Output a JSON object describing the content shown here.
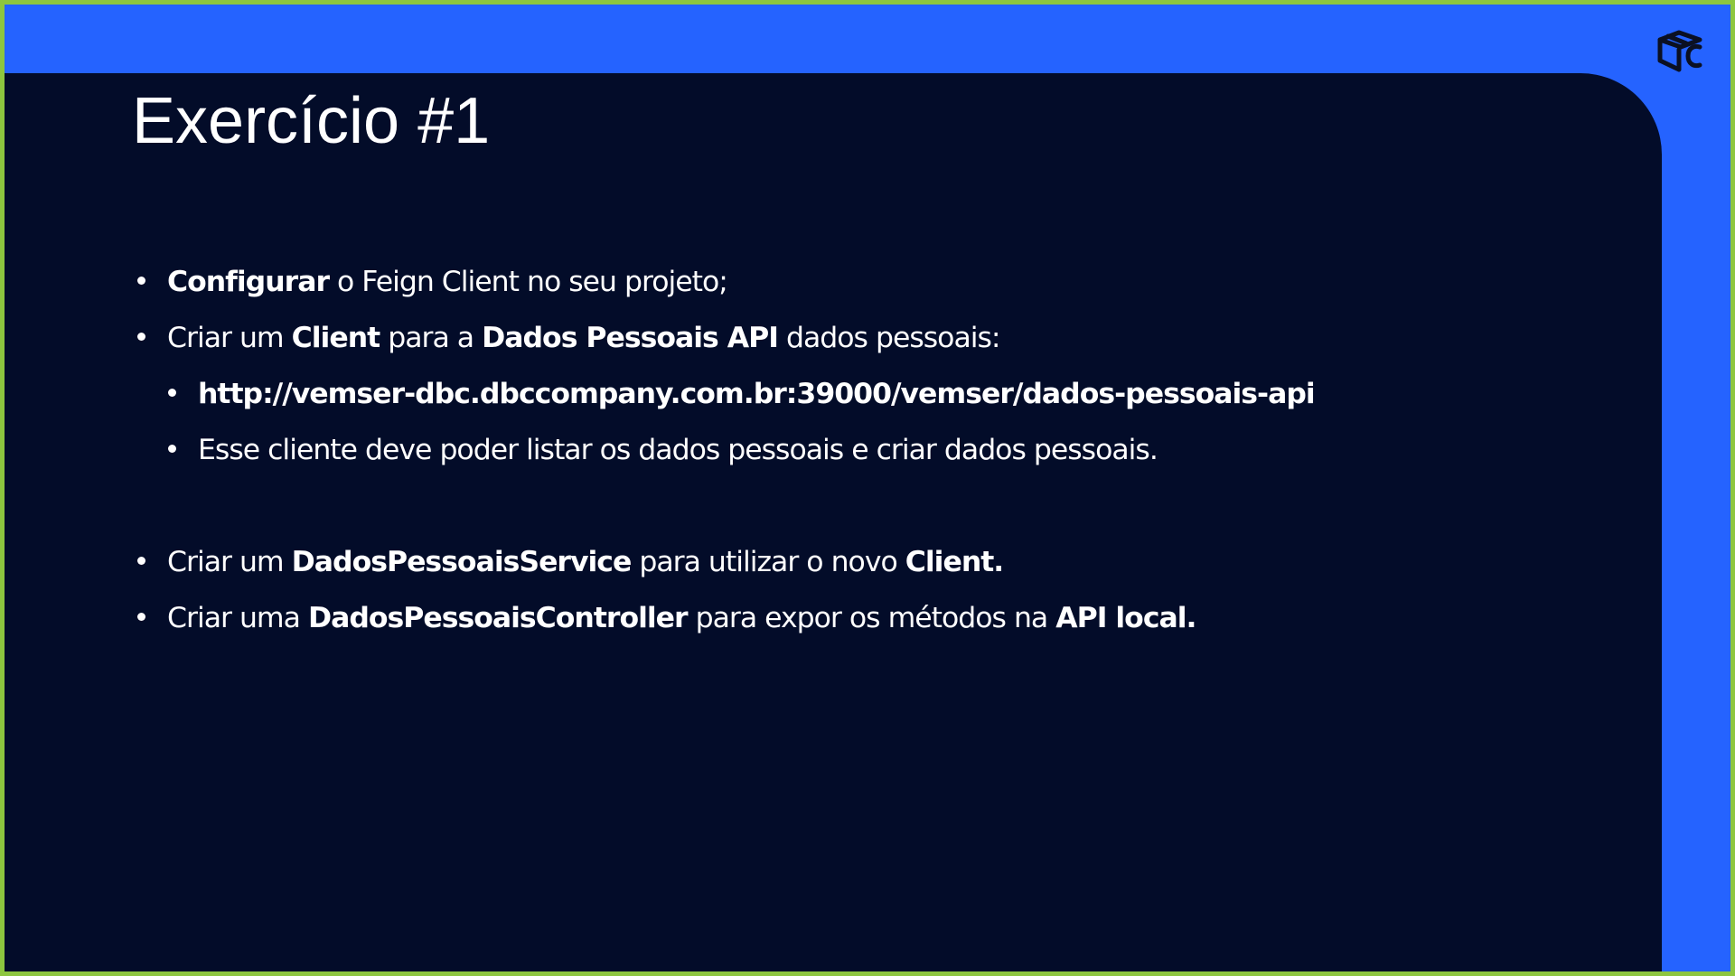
{
  "slide": {
    "title": "Exercício #1",
    "colors": {
      "accent": "#2563ff",
      "panel": "#030c29",
      "frame": "#8dc63f",
      "text": "#ffffff"
    },
    "logo_icon": "dbc-cube-logo-icon",
    "bullets": [
      {
        "level": 1,
        "parts": [
          {
            "text": "Configurar",
            "bold": true
          },
          {
            "text": " o Feign Client no seu projeto;",
            "bold": false
          }
        ]
      },
      {
        "level": 1,
        "parts": [
          {
            "text": "Criar um ",
            "bold": false
          },
          {
            "text": "Client",
            "bold": true
          },
          {
            "text": " para a ",
            "bold": false
          },
          {
            "text": "Dados Pessoais API",
            "bold": true
          },
          {
            "text": " dados pessoais:",
            "bold": false
          }
        ]
      },
      {
        "level": 2,
        "parts": [
          {
            "text": "http://vemser-dbc.dbccompany.com.br:39000/vemser/dados-pessoais-api",
            "bold": true
          }
        ]
      },
      {
        "level": 2,
        "parts": [
          {
            "text": "Esse cliente deve poder listar os dados pessoais e criar dados pessoais.",
            "bold": false
          }
        ]
      },
      {
        "level": 1,
        "parts": [
          {
            "text": "Criar um ",
            "bold": false
          },
          {
            "text": "DadosPessoaisService",
            "bold": true
          },
          {
            "text": " para utilizar o novo ",
            "bold": false
          },
          {
            "text": "Client.",
            "bold": true
          }
        ]
      },
      {
        "level": 1,
        "parts": [
          {
            "text": "Criar uma ",
            "bold": false
          },
          {
            "text": "DadosPessoaisController",
            "bold": true
          },
          {
            "text": " para expor os métodos na ",
            "bold": false
          },
          {
            "text": "API local.",
            "bold": true
          }
        ]
      }
    ]
  }
}
